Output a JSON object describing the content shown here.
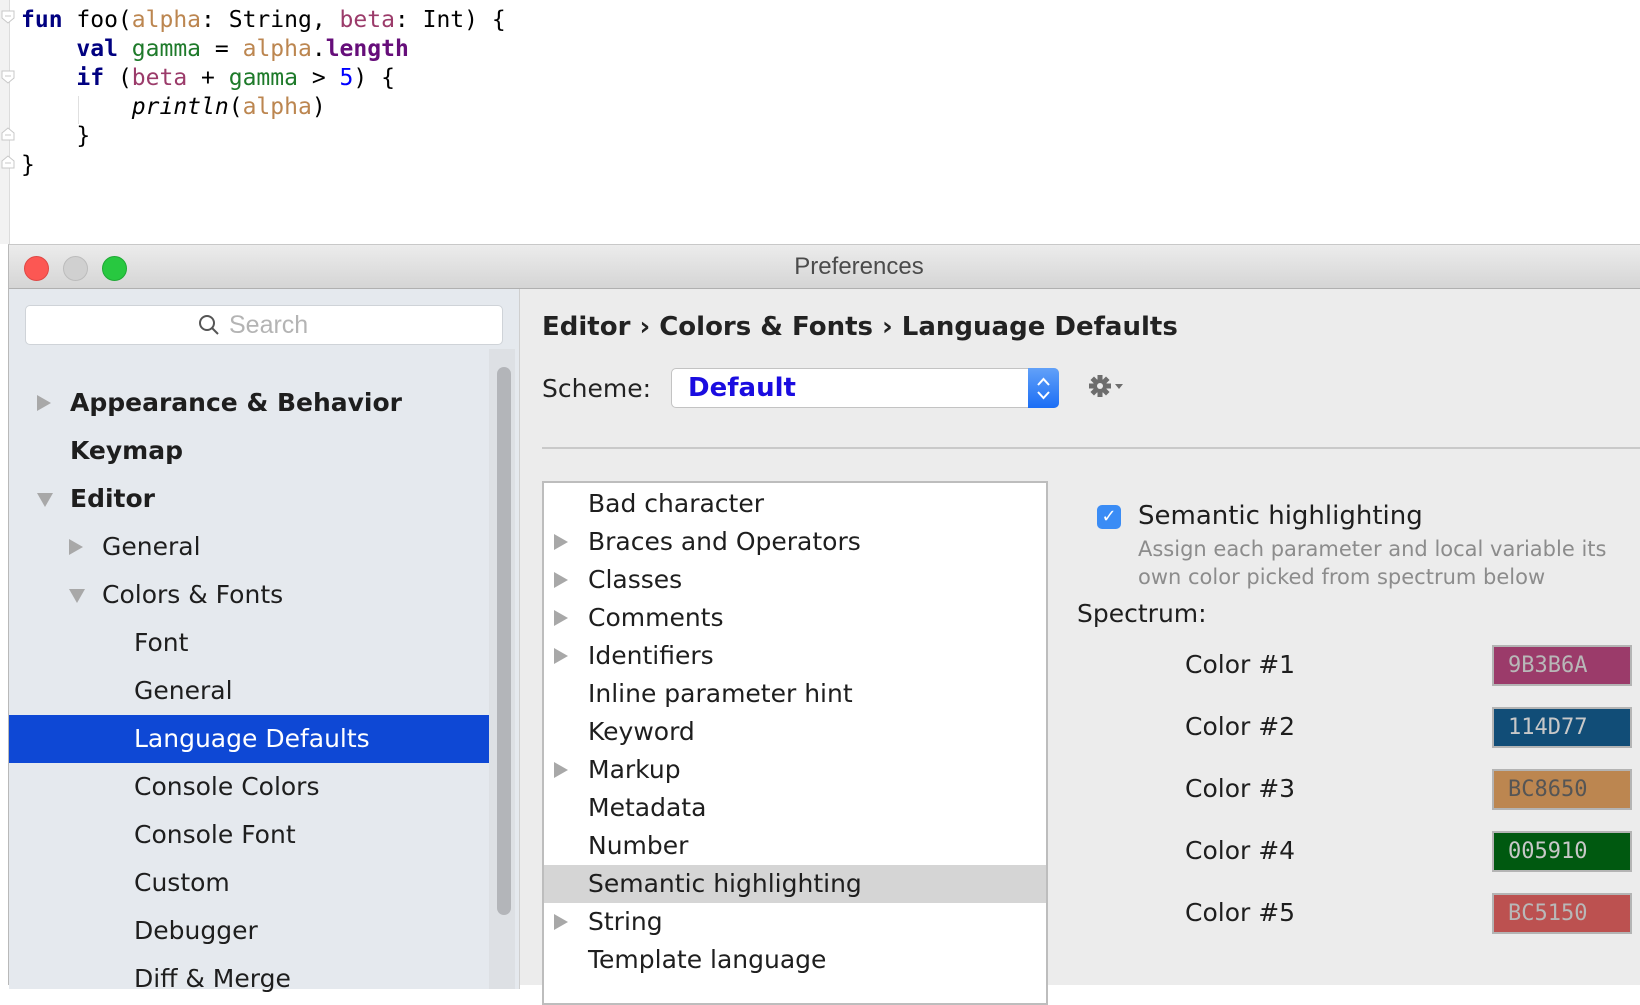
{
  "editor": {
    "lines": [
      [
        {
          "t": "fun",
          "c": "kw"
        },
        {
          "t": " foo("
        },
        {
          "t": "alpha",
          "c": "p1"
        },
        {
          "t": ": String, "
        },
        {
          "t": "beta",
          "c": "p2"
        },
        {
          "t": ": Int) {"
        }
      ],
      [
        {
          "t": "    "
        },
        {
          "t": "val",
          "c": "kw"
        },
        {
          "t": " "
        },
        {
          "t": "gamma",
          "c": "v3"
        },
        {
          "t": " = "
        },
        {
          "t": "alpha",
          "c": "p1"
        },
        {
          "t": "."
        },
        {
          "t": "length",
          "c": "prop"
        }
      ],
      [
        {
          "t": "    "
        },
        {
          "t": "if",
          "c": "kw"
        },
        {
          "t": " ("
        },
        {
          "t": "beta",
          "c": "p2"
        },
        {
          "t": " + "
        },
        {
          "t": "gamma",
          "c": "v3"
        },
        {
          "t": " > "
        },
        {
          "t": "5",
          "c": "num"
        },
        {
          "t": ") {"
        }
      ],
      [
        {
          "t": "        "
        },
        {
          "t": "println",
          "c": "it"
        },
        {
          "t": "("
        },
        {
          "t": "alpha",
          "c": "p1"
        },
        {
          "t": ")"
        }
      ],
      [
        {
          "t": "    }"
        }
      ],
      [
        {
          "t": "}"
        }
      ]
    ]
  },
  "dialog": {
    "title": "Preferences",
    "search_placeholder": "Search",
    "tree": [
      {
        "label": "Appearance & Behavior",
        "level": 0,
        "bold": true,
        "arrow": "right"
      },
      {
        "label": "Keymap",
        "level": 0,
        "bold": true,
        "arrow": "none"
      },
      {
        "label": "Editor",
        "level": 0,
        "bold": true,
        "arrow": "down"
      },
      {
        "label": "General",
        "level": 1,
        "bold": false,
        "arrow": "right"
      },
      {
        "label": "Colors & Fonts",
        "level": 1,
        "bold": false,
        "arrow": "down"
      },
      {
        "label": "Font",
        "level": 2,
        "bold": false,
        "arrow": "none"
      },
      {
        "label": "General",
        "level": 2,
        "bold": false,
        "arrow": "none"
      },
      {
        "label": "Language Defaults",
        "level": 2,
        "bold": false,
        "arrow": "none",
        "selected": true
      },
      {
        "label": "Console Colors",
        "level": 2,
        "bold": false,
        "arrow": "none"
      },
      {
        "label": "Console Font",
        "level": 2,
        "bold": false,
        "arrow": "none"
      },
      {
        "label": "Custom",
        "level": 2,
        "bold": false,
        "arrow": "none"
      },
      {
        "label": "Debugger",
        "level": 2,
        "bold": false,
        "arrow": "none"
      },
      {
        "label": "Diff & Merge",
        "level": 2,
        "bold": false,
        "arrow": "none"
      }
    ],
    "breadcrumb": "Editor › Colors & Fonts › Language Defaults",
    "scheme_label": "Scheme:",
    "scheme_value": "Default",
    "gear_label": "⚙▾",
    "list": [
      {
        "label": "Bad character",
        "expandable": false
      },
      {
        "label": "Braces and Operators",
        "expandable": true
      },
      {
        "label": "Classes",
        "expandable": true
      },
      {
        "label": "Comments",
        "expandable": true
      },
      {
        "label": "Identifiers",
        "expandable": true
      },
      {
        "label": "Inline parameter hint",
        "expandable": false
      },
      {
        "label": "Keyword",
        "expandable": false
      },
      {
        "label": "Markup",
        "expandable": true
      },
      {
        "label": "Metadata",
        "expandable": false
      },
      {
        "label": "Number",
        "expandable": false
      },
      {
        "label": "Semantic highlighting",
        "expandable": false,
        "selected": true
      },
      {
        "label": "String",
        "expandable": true
      },
      {
        "label": "Template language",
        "expandable": false
      }
    ],
    "semantic": {
      "checked": true,
      "label": "Semantic highlighting",
      "desc1": "Assign each parameter and local variable its",
      "desc2": "own color picked from spectrum below",
      "spectrum_label": "Spectrum:",
      "colors": [
        {
          "label": "Color #1",
          "hex": "9B3B6A",
          "bg": "#9b3b6a",
          "fg": "#b8b8b8"
        },
        {
          "label": "Color #2",
          "hex": "114D77",
          "bg": "#114d77",
          "fg": "#c8c8c8"
        },
        {
          "label": "Color #3",
          "hex": "BC8650",
          "bg": "#bc8650",
          "fg": "#555555"
        },
        {
          "label": "Color #4",
          "hex": "005910",
          "bg": "#005910",
          "fg": "#c8c8c8"
        },
        {
          "label": "Color #5",
          "hex": "BC5150",
          "bg": "#bc5150",
          "fg": "#b8b8b8"
        }
      ]
    }
  },
  "colors": {
    "selection": "#0e48d5",
    "close": "#fc5753",
    "minimize": "#d0d0d0",
    "zoom": "#28c840"
  }
}
